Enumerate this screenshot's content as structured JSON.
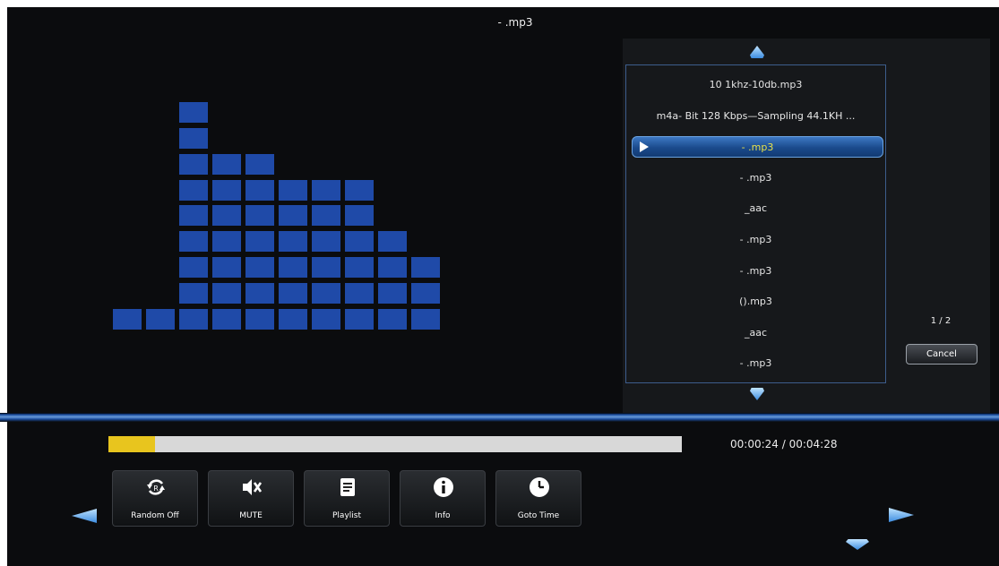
{
  "now_playing": {
    "title": "- .mp3"
  },
  "equalizer": {
    "levels": [
      1,
      1,
      9,
      7,
      7,
      6,
      6,
      6,
      4,
      3
    ],
    "max_level": 9,
    "color": "#1f4aa8"
  },
  "playlist": {
    "items": [
      {
        "label": "10 1khz-10db.mp3",
        "selected": false
      },
      {
        "label": "m4a- Bit 128 Kbps—Sampling 44.1KH ...",
        "selected": false
      },
      {
        "label": "- .mp3",
        "selected": true
      },
      {
        "label": "- .mp3",
        "selected": false
      },
      {
        "label": "_aac",
        "selected": false
      },
      {
        "label": "- .mp3",
        "selected": false
      },
      {
        "label": "- .mp3",
        "selected": false
      },
      {
        "label": "().mp3",
        "selected": false
      },
      {
        "label": "_aac",
        "selected": false
      },
      {
        "label": "- .mp3",
        "selected": false
      }
    ],
    "page_indicator": "1 / 2",
    "cancel_label": "Cancel",
    "selected_text_color": "#e8e24a"
  },
  "progress": {
    "fraction": 0.082,
    "elapsed": "00:00:24",
    "separator": " / ",
    "total": "00:04:28",
    "fill_color": "#e8c51e"
  },
  "controls": {
    "random": {
      "label": "Random Off",
      "icon": "shuffle-icon"
    },
    "mute": {
      "label": "MUTE",
      "icon": "speaker-mute-icon"
    },
    "playlist": {
      "label": "Playlist",
      "icon": "document-icon"
    },
    "info": {
      "label": "Info",
      "icon": "info-icon"
    },
    "goto": {
      "label": "Goto Time",
      "icon": "clock-icon"
    }
  }
}
